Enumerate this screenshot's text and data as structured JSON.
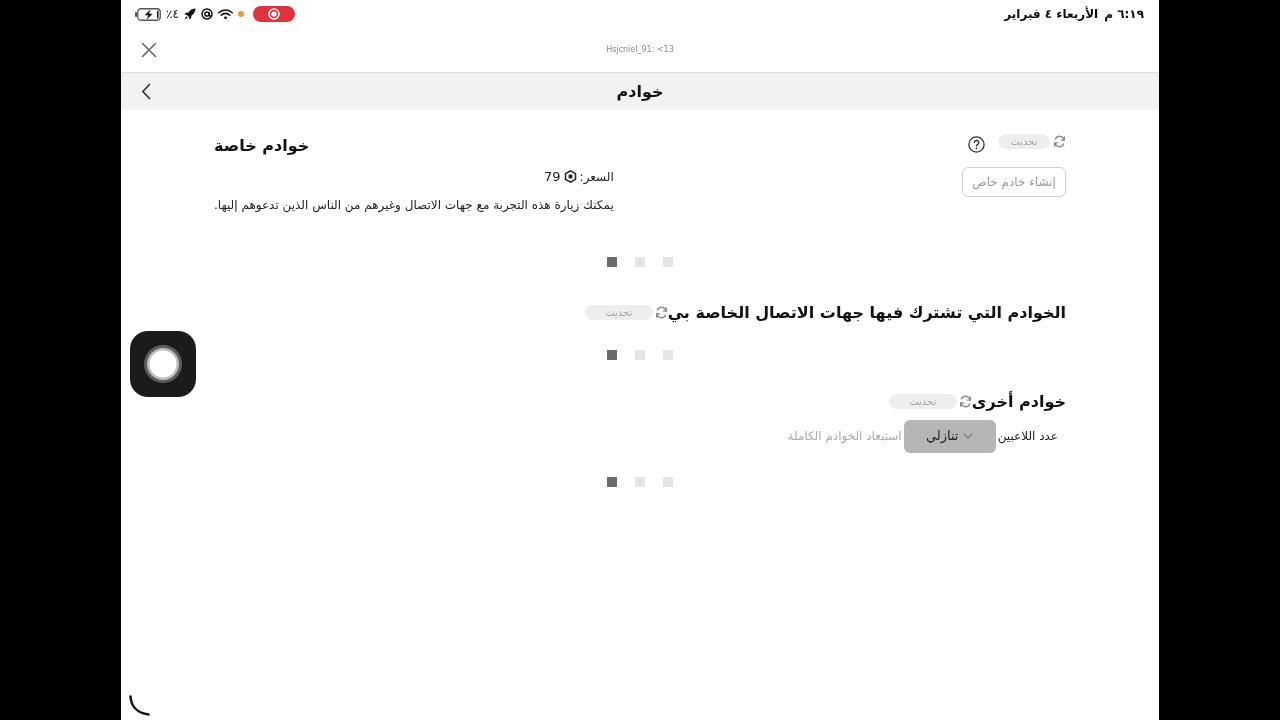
{
  "status_bar": {
    "time": "٦:١٩ م",
    "date": "الأربعاء ٤ فبراير",
    "battery_percent": "٪٤",
    "charging": true,
    "screen_recording": true
  },
  "top_bar": {
    "user_label": "Hsjcniel_91: <13"
  },
  "nav": {
    "title": "خوادم"
  },
  "private_servers": {
    "title": "خوادم خاصة",
    "refresh_label": "تحديث",
    "create_button": "إنشاء خادم خاص",
    "price_label": "السعر:",
    "price": "79",
    "description": "يمكنك زيارة هذه التجربة مع جهات الاتصال وغيرهم من الناس الذين تدعوهم إليها.",
    "loading": true
  },
  "friends_servers": {
    "title": "الخوادم التي تشترك فيها جهات الاتصال الخاصة بي",
    "refresh_label": "تحديث",
    "loading": true
  },
  "other_servers": {
    "title": "خوادم أخرى",
    "refresh_label": "تحديث",
    "player_count_label": "عدد اللاعبين",
    "sort_value": "تنازلي",
    "exclude_full_label": "استبعاد الخوادم الكاملة",
    "loading": true
  }
}
